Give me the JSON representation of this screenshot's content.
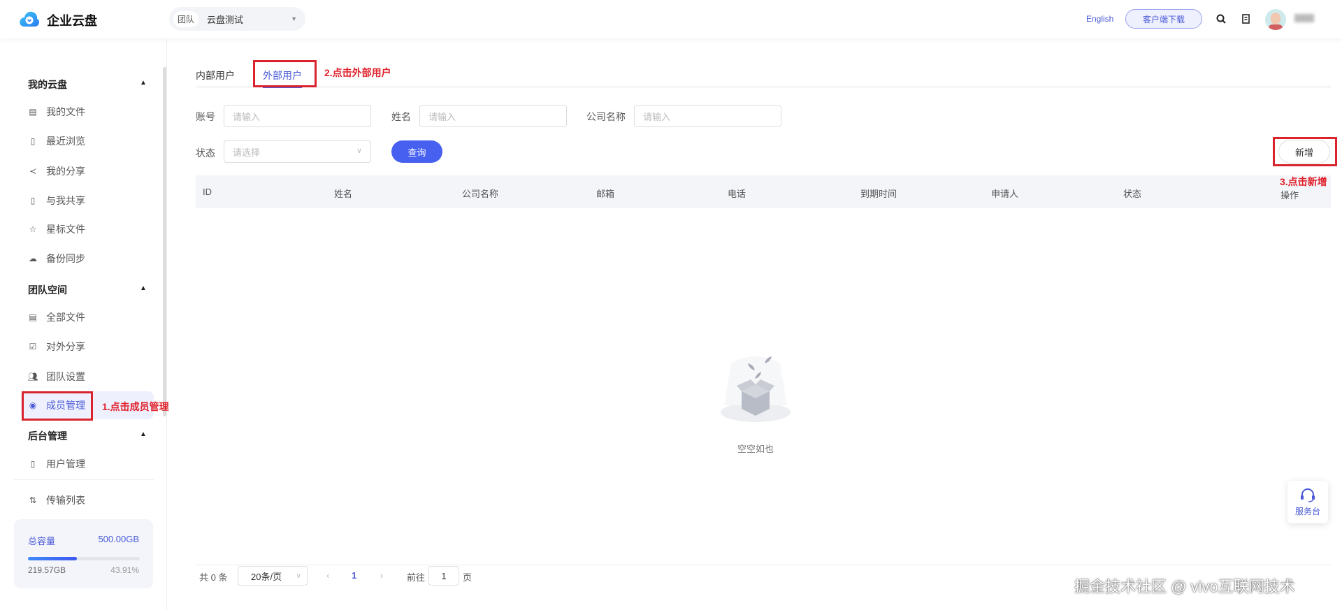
{
  "header": {
    "app_title": "企业云盘",
    "team_tag": "团队",
    "team_name": "云盘测试",
    "language": "English",
    "download_client": "客户端下载"
  },
  "sidebar": {
    "sections": [
      {
        "title": "我的云盘",
        "items": [
          {
            "label": "我的文件",
            "icon": "file-icon"
          },
          {
            "label": "最近浏览",
            "icon": "recent-file-icon"
          },
          {
            "label": "我的分享",
            "icon": "share-icon"
          },
          {
            "label": "与我共享",
            "icon": "shared-with-me-icon"
          },
          {
            "label": "星标文件",
            "icon": "star-icon"
          },
          {
            "label": "备份同步",
            "icon": "cloud-sync-icon"
          }
        ]
      },
      {
        "title": "团队空间",
        "items": [
          {
            "label": "全部文件",
            "icon": "list-icon"
          },
          {
            "label": "对外分享",
            "icon": "checklist-icon"
          },
          {
            "label": "团队设置",
            "icon": "team-icon"
          },
          {
            "label": "成员管理",
            "icon": "user-circle-icon",
            "active": true
          }
        ]
      },
      {
        "title": "后台管理",
        "items": [
          {
            "label": "用户管理",
            "icon": "id-card-icon"
          }
        ]
      }
    ],
    "transfer": "传输列表",
    "storage": {
      "label": "总容量",
      "total": "500.00GB",
      "used": "219.57GB",
      "percent_text": "43.91%",
      "percent": 43.91
    }
  },
  "annotations": {
    "step1": "1.点击成员管理",
    "step2": "2.点击外部用户",
    "step3": "3.点击新增"
  },
  "main": {
    "tabs": [
      {
        "label": "内部用户"
      },
      {
        "label": "外部用户",
        "active": true
      }
    ],
    "filters": {
      "account_label": "账号",
      "account_placeholder": "请输入",
      "name_label": "姓名",
      "name_placeholder": "请输入",
      "company_label": "公司名称",
      "company_placeholder": "请输入",
      "status_label": "状态",
      "status_placeholder": "请选择"
    },
    "query_button": "查询",
    "add_button": "新增",
    "columns": [
      "ID",
      "姓名",
      "公司名称",
      "邮箱",
      "电话",
      "到期时间",
      "申请人",
      "状态",
      "操作"
    ],
    "empty_text": "空空如也",
    "pagination": {
      "total": "共 0 条",
      "page_size": "20条/页",
      "current": "1",
      "goto": "前往",
      "goto_value": "1",
      "page_unit": "页"
    }
  },
  "service_desk": "服务台",
  "watermark": "掘金技术社区 @ vivo互联网技术",
  "colors": {
    "accent": "#4a5ad6",
    "primary_button": "#4760f0",
    "annotation_red": "#d9232d"
  }
}
